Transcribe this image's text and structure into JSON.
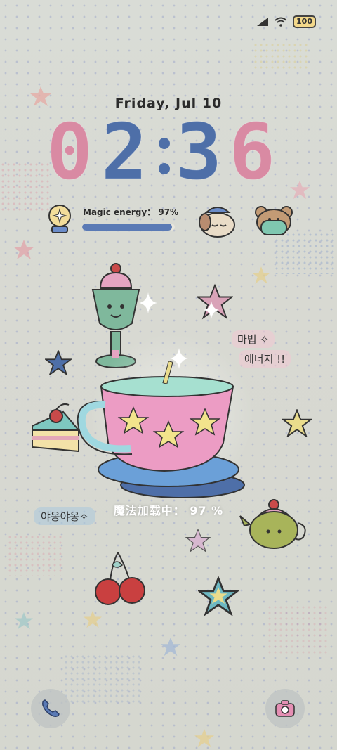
{
  "status_bar": {
    "battery": "100",
    "icons": [
      "cellular-signal-icon",
      "wifi-icon",
      "battery-icon"
    ]
  },
  "lockscreen": {
    "date": "Friday, Jul 10",
    "time_digits": [
      "0",
      "2",
      "3",
      "6"
    ],
    "energy": {
      "label": "Magic energy： 97%",
      "level": 0.97
    },
    "korean_text_1": "마법 ✧",
    "korean_text_2": "에너지 !!",
    "korean_text_3": "야옹야옹✧",
    "magic_loading": "魔法加载中： 97 %"
  },
  "shortcuts": {
    "left": "phone-icon",
    "right": "camera-icon"
  },
  "colors": {
    "clock_pink": "#d98aa3",
    "clock_blue": "#4e6fa8",
    "energy_fill": "#5a7ab5"
  }
}
